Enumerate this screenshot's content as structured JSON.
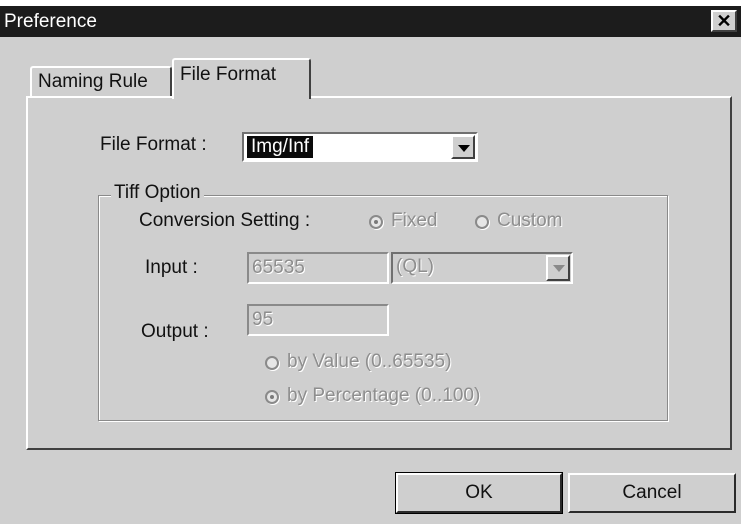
{
  "window": {
    "title": "Preference",
    "close_glyph": "✕"
  },
  "tabs": [
    {
      "label": "Naming Rule",
      "active": false
    },
    {
      "label": "File Format",
      "active": true
    }
  ],
  "file_format": {
    "label": "File Format :",
    "selected": "Img/Inf"
  },
  "tiff_option": {
    "legend": "Tiff Option",
    "conversion_label": "Conversion Setting :",
    "conversion_options": [
      {
        "label": "Fixed",
        "selected": true
      },
      {
        "label": "Custom",
        "selected": false
      }
    ],
    "input_label": "Input :",
    "input_value": "65535",
    "input_unit": "(QL)",
    "output_label": "Output :",
    "output_value": "95",
    "output_modes": [
      {
        "label": "by Value (0..65535)",
        "selected": false
      },
      {
        "label": "by Percentage (0..100)",
        "selected": true
      }
    ]
  },
  "buttons": {
    "ok": "OK",
    "cancel": "Cancel"
  },
  "colors": {
    "face": "#cfcfcf",
    "titlebar": "#1c1c1c",
    "disabled_text": "#8e8e8e"
  }
}
